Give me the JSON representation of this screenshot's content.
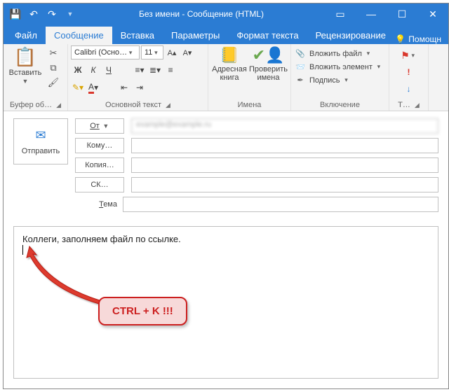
{
  "titlebar": {
    "title": "Без имени - Сообщение (HTML)"
  },
  "tabs": {
    "file": "Файл",
    "message": "Сообщение",
    "insert": "Вставка",
    "options": "Параметры",
    "format": "Формат текста",
    "review": "Рецензирование",
    "help": "Помощн"
  },
  "ribbon": {
    "paste_label": "Вставить",
    "clipboard_group": "Буфер об…",
    "font_name": "Calibri (Осно…",
    "font_size": "11",
    "font_group": "Основной текст",
    "bold": "Ж",
    "italic": "К",
    "underline": "Ч",
    "address_book": "Адресная книга",
    "check_names": "Проверить имена",
    "names_group": "Имена",
    "attach_file": "Вложить файл",
    "attach_item": "Вложить элемент",
    "signature": "Подпись",
    "include_group": "Включение",
    "tags_group": "Т…"
  },
  "compose": {
    "send": "Отправить",
    "from": "От",
    "to": "Кому…",
    "cc": "Копия…",
    "bcc": "СК…",
    "subject": "Тема",
    "from_value": "example@example.ru"
  },
  "body": {
    "text": "Коллеги, заполняем файл по ссылке."
  },
  "callout": {
    "text": "CTRL + K !!!"
  }
}
